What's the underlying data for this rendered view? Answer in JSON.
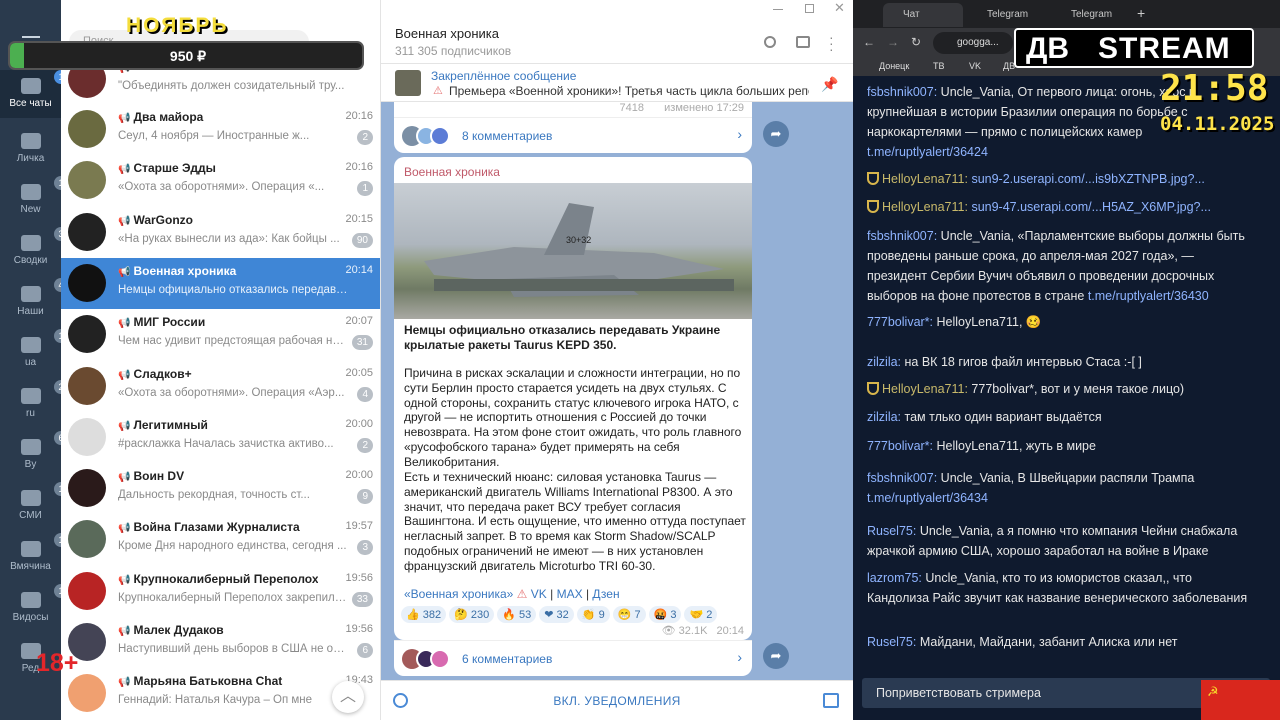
{
  "overlay": {
    "month": "НОЯБРЬ",
    "amount": "950 ₽",
    "age": "18+",
    "clock_time": "21:58",
    "clock_date": "04.11.2025",
    "brand_left": "ДВ",
    "brand_right": "STREAM"
  },
  "folders": [
    {
      "label": "Все чаты",
      "badge": "173"
    },
    {
      "label": "Личка",
      "badge": ""
    },
    {
      "label": "New",
      "badge": "154"
    },
    {
      "label": "Сводки",
      "badge": "32"
    },
    {
      "label": "Наши",
      "badge": "46"
    },
    {
      "label": "ua",
      "badge": "12"
    },
    {
      "label": "ru",
      "badge": "23"
    },
    {
      "label": "By",
      "badge": "6"
    },
    {
      "label": "СМИ",
      "badge": "12"
    },
    {
      "label": "Вмячина",
      "badge": "16"
    },
    {
      "label": "Видосы",
      "badge": "10"
    },
    {
      "label": "Ред",
      "badge": ""
    }
  ],
  "search_placeholder": "Поиск",
  "chats": [
    {
      "name": "",
      "time": "",
      "preview": "\"Объединять должен созидательный тру...",
      "count": ""
    },
    {
      "name": "Два майора",
      "time": "20:16",
      "preview": "Сеул, 4 ноября — Иностранные ж...",
      "count": "2"
    },
    {
      "name": "Старше Эдды",
      "time": "20:16",
      "preview": "«Охота за оборотнями». Операция «...",
      "count": "1"
    },
    {
      "name": "WarGonzo",
      "time": "20:15",
      "preview": "«На руках вынесли из ада»: Как бойцы ...",
      "count": "90"
    },
    {
      "name": "Военная хроника",
      "time": "20:14",
      "preview": "Немцы официально отказались передавать...",
      "count": ""
    },
    {
      "name": "МИГ России",
      "time": "20:07",
      "preview": "Чем нас удивит предстоящая рабочая нед...",
      "count": "31"
    },
    {
      "name": "Сладков+",
      "time": "20:05",
      "preview": "«Охота за оборотнями». Операция «Аэр...",
      "count": "4"
    },
    {
      "name": "Легитимный",
      "time": "20:00",
      "preview": "#расклажка  Началась зачистка активо...",
      "count": "2"
    },
    {
      "name": "Воин DV",
      "time": "20:00",
      "preview": "Дальность рекордная, точность ст...",
      "count": "9"
    },
    {
      "name": "Война Глазами Журналиста",
      "time": "19:57",
      "preview": "Кроме Дня народного единства, сегодня ...",
      "count": "3"
    },
    {
      "name": "Крупнокалиберный Переполох",
      "time": "19:56",
      "preview": "Крупнокалиберный Переполох закрепил(...",
      "count": "33"
    },
    {
      "name": "Малек Дудаков",
      "time": "19:56",
      "preview": "Наступивший день выборов в США не обо...",
      "count": "6"
    },
    {
      "name": "Марьяна Батьковна Chat",
      "time": "19:43",
      "preview": "Геннадий: Наталья Качура – Оп мне",
      "count": ""
    }
  ],
  "channel": {
    "title": "Военная хроника",
    "subs": "311 305 подписчиков"
  },
  "pinned": {
    "title": "Закреплённое сообщение",
    "text": "Премьера «Военной хроники»! Третья часть цикла больших репо..."
  },
  "prev_post": {
    "views": "7418",
    "edited": "изменено 17:29",
    "comments": "8 комментариев"
  },
  "post": {
    "author": "Военная хроника",
    "headline": "Немцы официально отказались передавать Украине крылатые ракеты Taurus KEPD 350.",
    "p1": "Причина в рисках эскалации и сложности интеграции, но по сути Берлин просто старается усидеть на двух стульях. С одной стороны, сохранить статус ключевого игрока НАТО, с другой — не испортить отношения с Россией до точки невозврата. На этом фоне стоит ожидать, что роль главного «русофобского тарана» будет примерять на себя Великобритания.",
    "p2": "Есть и технический нюанс: силовая установка Taurus — американский двигатель Williams International P8300. А это значит, что передача ракет ВСУ требует согласия Вашингтона. И есть ощущение, что именно оттуда поступает негласный запрет. В то время как Storm Shadow/SCALP подобных ограничений не имеют — в них установлен французский двигатель Microturbo TRI 60-30.",
    "footer_a": "«Военная хроника»",
    "footer_vk": "VK",
    "footer_max": "MAX",
    "footer_dzen": "Дзен",
    "reactions": [
      {
        "e": "👍",
        "n": "382"
      },
      {
        "e": "🤔",
        "n": "230"
      },
      {
        "e": "🔥",
        "n": "53"
      },
      {
        "e": "❤",
        "n": "32"
      },
      {
        "e": "👏",
        "n": "9"
      },
      {
        "e": "😁",
        "n": "7"
      },
      {
        "e": "🤬",
        "n": "3"
      },
      {
        "e": "🤝",
        "n": "2"
      }
    ],
    "views": "32.1K",
    "time": "20:14",
    "comments": "6 комментариев",
    "jet_label": "30+32"
  },
  "notify_btn": "ВКЛ. УВЕДОМЛЕНИЯ",
  "browser": {
    "tabs": [
      "Чат",
      "Telegram",
      "Telegram"
    ],
    "url": "googga...",
    "bookmarks": [
      "Донецк",
      "ТВ",
      "VK",
      "ДВ"
    ],
    "messages": [
      {
        "u": "fsbshnik007:",
        "t": " Uncle_Vania, От первого лица: огонь, хаос и крупнейшая в истории Бразилии операция по борьбе с наркокартелями — прямо с полицейских камер ",
        "l": "t.me/ruptlyalert/36424",
        "badge": false
      },
      {
        "u": "HelloyLena711:",
        "t": " ",
        "l": "sun9-2.userapi.com/...is9bXZTNPB.jpg?...",
        "badge": true
      },
      {
        "u": "HelloyLena711:",
        "t": " ",
        "l": "sun9-47.userapi.com/...H5AZ_X6MP.jpg?...",
        "badge": true
      },
      {
        "u": "fsbshnik007:",
        "t": " Uncle_Vania, «Парламентские выборы должны быть проведены раньше срока, до апреля-мая 2027 года», — президент Сербии Вучич объявил о проведении досрочных выборов на фоне протестов в стране ",
        "l": "t.me/ruptlyalert/36430",
        "badge": false
      },
      {
        "u": "777bolivar*:",
        "t": " HelloyLena711, 🥴",
        "l": "",
        "badge": false
      },
      {
        "u": "zilzila:",
        "t": " на ВК 18 гигов файл интервью Стаса :-[ ]",
        "l": "",
        "badge": false
      },
      {
        "u": "HelloyLena711:",
        "t": " 777bolivar*, вот и у меня такое лицо)",
        "l": "",
        "badge": true
      },
      {
        "u": "zilzila:",
        "t": " там тлько один вариант выдаётся",
        "l": "",
        "badge": false
      },
      {
        "u": "777bolivar*:",
        "t": " HelloyLena711, жуть в мире",
        "l": "",
        "badge": false
      },
      {
        "u": "fsbshnik007:",
        "t": " Uncle_Vania, В Швейцарии распяли Трампа ",
        "l": "t.me/ruptlyalert/36434",
        "badge": false
      },
      {
        "u": "Rusel75:",
        "t": " Uncle_Vania, а я помню что компания Чейни снабжала жрачкой армию США, хорошо заработал на войне в Ираке",
        "l": "",
        "badge": false
      },
      {
        "u": "lazrom75:",
        "t": " Uncle_Vania, кто то из юмористов сказал,, что Кандолиза Райс звучит как название венерического заболевания",
        "l": "",
        "badge": false
      },
      {
        "u": "Rusel75:",
        "t": " Майдани, Майдани, забанит Алиска или нет",
        "l": "",
        "badge": false
      }
    ],
    "greet_btn": "Поприветствовать стримера"
  }
}
